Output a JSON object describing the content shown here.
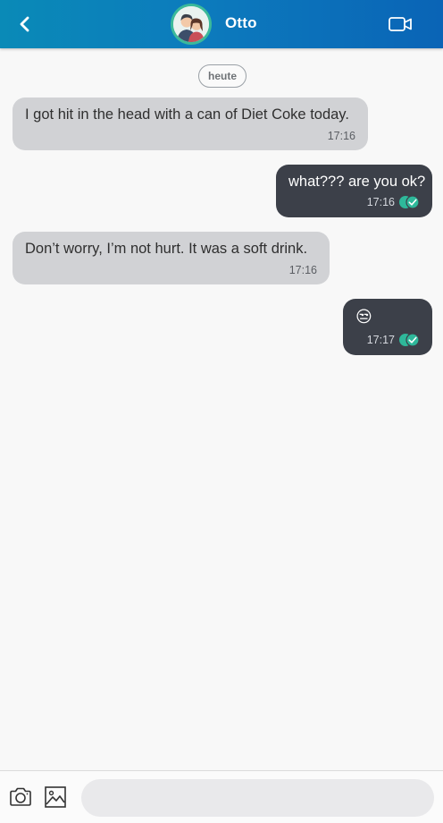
{
  "header": {
    "contact_name": "Otto",
    "accent_gradient": [
      "#0a8ab7",
      "#0a64b6"
    ],
    "avatar_ring_color": "#3bb99a",
    "icons": {
      "back": "chevron-left-icon",
      "video": "video-camera-icon",
      "avatar": "couple-avatar-icon"
    }
  },
  "conversation": {
    "date_label": "heute",
    "messages": [
      {
        "direction": "incoming",
        "text": "I got hit in the head with a can of Diet Coke today.",
        "time": "17:16"
      },
      {
        "direction": "outgoing",
        "text": "what??? are you ok?",
        "time": "17:16",
        "status": "read"
      },
      {
        "direction": "incoming",
        "text": "Don’t worry, I’m not hurt. It was a soft drink.",
        "time": "17:16"
      },
      {
        "direction": "outgoing",
        "text": "😒",
        "time": "17:17",
        "status": "read"
      }
    ],
    "colors": {
      "incoming_bubble": "#d1d2d5",
      "outgoing_bubble": "#3c4049",
      "read_check": "#2eb89a"
    }
  },
  "composer": {
    "input_value": "",
    "input_placeholder": "",
    "icons": {
      "camera": "camera-icon",
      "gallery": "image-gallery-icon"
    }
  }
}
